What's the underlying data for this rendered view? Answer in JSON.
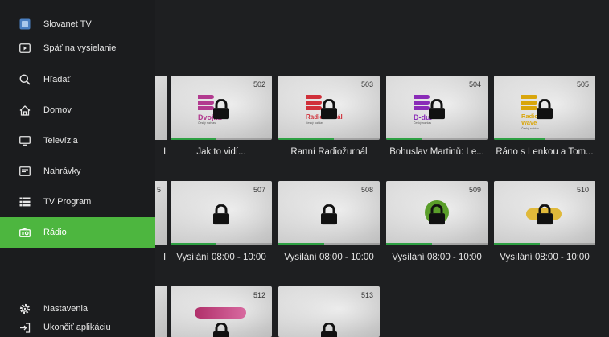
{
  "colors": {
    "accent": "#4db63f",
    "progress": "#2ea043",
    "background": "#1e1f21",
    "sidebar": "#1b1c1e"
  },
  "sidebar": {
    "header": [
      {
        "label": "Slovanet TV",
        "icon": "slovanet-logo-icon"
      },
      {
        "label": "Späť na vysielanie",
        "icon": "play-back-icon"
      }
    ],
    "items": [
      {
        "label": "Hľadať",
        "icon": "search-icon"
      },
      {
        "label": "Domov",
        "icon": "home-icon"
      },
      {
        "label": "Televízia",
        "icon": "tv-icon"
      },
      {
        "label": "Nahrávky",
        "icon": "recordings-icon"
      },
      {
        "label": "TV Program",
        "icon": "tv-program-icon"
      },
      {
        "label": "Rádio",
        "icon": "radio-icon",
        "active": true
      }
    ],
    "footer": [
      {
        "label": "Nastavenia",
        "icon": "gear-icon"
      },
      {
        "label": "Ukončiť aplikáciu",
        "icon": "exit-icon"
      }
    ]
  },
  "grid": {
    "rows": [
      {
        "partial_caption": "I",
        "tiles": [
          {
            "channel": "502",
            "caption": "Jak to vidí...",
            "logo": "Dvojka",
            "logo_sub": "Český rozhlas",
            "logo_color": "#b23a8f",
            "progress": 0.45
          },
          {
            "channel": "503",
            "caption": "Ranní Radiožurnál",
            "logo": "Radiožurnál",
            "logo_sub": "Český rozhlas",
            "logo_color": "#d0303a",
            "progress": 0.55
          },
          {
            "channel": "504",
            "caption": "Bohuslav Martinů: Le...",
            "logo": "D-dur",
            "logo_sub": "Český rozhlas",
            "logo_color": "#8a2bb8",
            "progress": 0.35
          },
          {
            "channel": "505",
            "caption": "Ráno s Lenkou a Tom...",
            "logo": "Radio Wave",
            "logo_sub": "Český rozhlas",
            "logo_color": "#d9a60c",
            "progress": 0.5
          }
        ]
      },
      {
        "partial_caption": "I",
        "partial_num": "5",
        "tiles": [
          {
            "channel": "507",
            "caption": "Vysílání 08:00 - 10:00",
            "progress": 0.45
          },
          {
            "channel": "508",
            "caption": "Vysílání 08:00 - 10:00",
            "progress": 0.45
          },
          {
            "channel": "509",
            "caption": "Vysílání 08:00 - 10:00",
            "progress": 0.45
          },
          {
            "channel": "510",
            "caption": "Vysílání 08:00 - 10:00",
            "progress": 0.45
          }
        ]
      },
      {
        "tiles": [
          {
            "channel": "512"
          },
          {
            "channel": "513"
          }
        ]
      }
    ]
  }
}
